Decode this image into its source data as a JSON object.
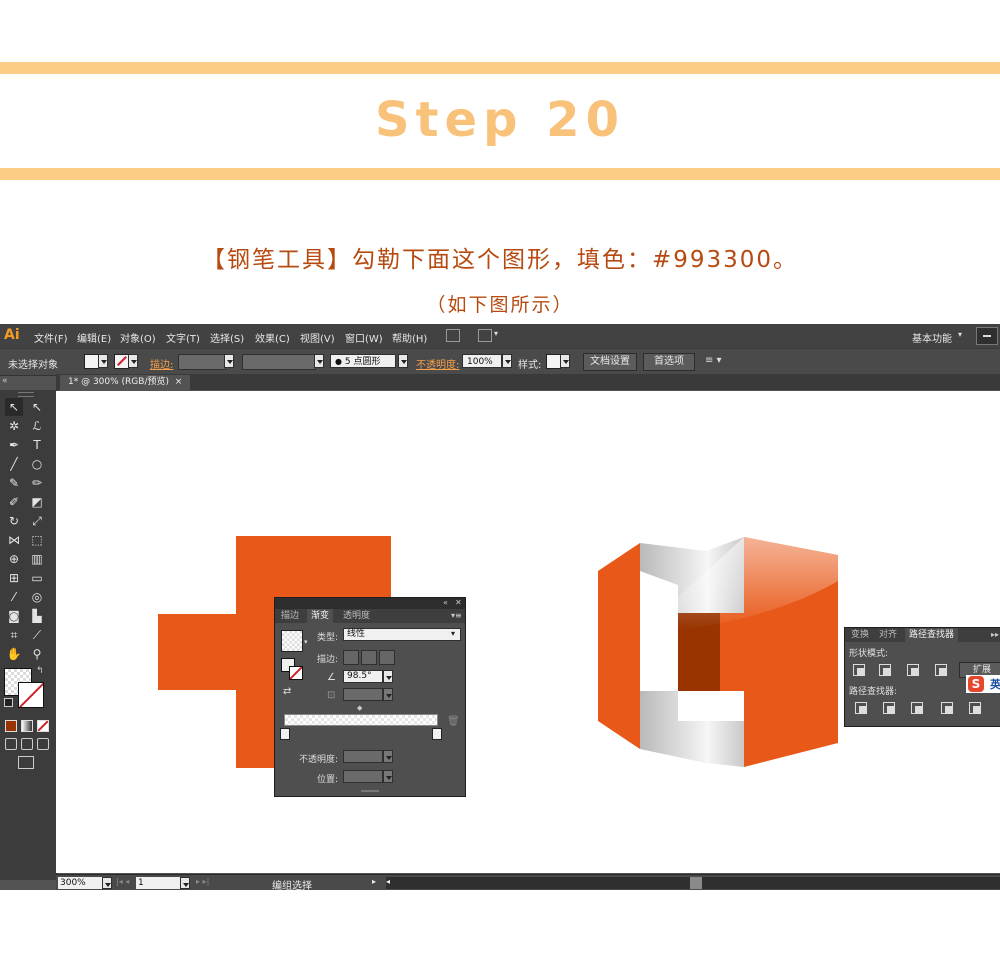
{
  "header": {
    "step_title": "Step 20",
    "instruction": "【钢笔工具】勾勒下面这个图形，填色：#993300。",
    "instruction_sub": "（如下图所示）"
  },
  "colors": {
    "accent_stripe": "#fbcd85",
    "title_color": "#f8c27b",
    "instruction_color": "#b64a10",
    "shape_orange": "#e85818",
    "fill_color": "#993300"
  },
  "app": {
    "logo": "Ai",
    "menu": [
      "文件(F)",
      "编辑(E)",
      "对象(O)",
      "文字(T)",
      "选择(S)",
      "效果(C)",
      "视图(V)",
      "窗口(W)",
      "帮助(H)"
    ],
    "workspace": "基本功能"
  },
  "control_bar": {
    "selection_status": "未选择对象",
    "stroke_label": "描边:",
    "brush_value": "5 点圆形",
    "opacity_label": "不透明度:",
    "opacity_value": "100%",
    "style_label": "样式:",
    "doc_setup_button": "文档设置",
    "preferences_button": "首选项"
  },
  "document": {
    "tab_label": "1* @ 300% (RGB/预览)"
  },
  "gradient_panel": {
    "tabs": [
      "描边",
      "渐变",
      "透明度"
    ],
    "active_tab": "渐变",
    "type_label": "类型:",
    "type_value": "线性",
    "stroke_label": "描边:",
    "angle_value": "98.5°",
    "opacity_label": "不透明度:",
    "position_label": "位置:"
  },
  "pathfinder_panel": {
    "tabs": [
      "变换",
      "对齐",
      "路径查找器"
    ],
    "active_tab": "路径查找器",
    "shape_modes_label": "形状模式:",
    "expand_button": "扩展",
    "pathfinders_label": "路径查找器:"
  },
  "ime": {
    "logo": "S",
    "mode": "英",
    "punctuation": "•,"
  },
  "status_bar": {
    "zoom": "300%",
    "page": "1",
    "status_text": "编组选择"
  }
}
